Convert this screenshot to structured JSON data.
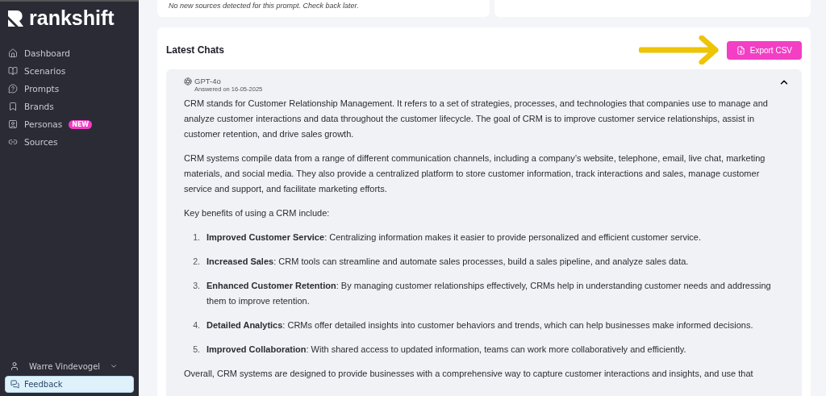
{
  "sidebar": {
    "logo": "rankshift",
    "items": [
      {
        "label": "Dashboard"
      },
      {
        "label": "Scenarios"
      },
      {
        "label": "Prompts"
      },
      {
        "label": "Brands"
      },
      {
        "label": "Personas",
        "badge": "NEW"
      },
      {
        "label": "Sources"
      }
    ],
    "user": "Warre Vindevogel",
    "feedback": "Feedback"
  },
  "top_card": {
    "text": "No new sources detected for this prompt. Check back later."
  },
  "latest_chats": {
    "title": "Latest Chats",
    "export_button": "Export CSV",
    "chat": {
      "model": "GPT-4o",
      "answered": "Answered on 16-05-2025",
      "expanded": true,
      "blocks": [
        {
          "kind": "p",
          "text": "CRM stands for Customer Relationship Management. It refers to a set of strategies, processes, and technologies that companies use to manage and analyze customer interactions and data throughout the customer lifecycle. The goal of CRM is to improve customer service relationships, assist in customer retention, and drive sales growth."
        },
        {
          "kind": "p",
          "text": "CRM systems compile data from a range of different communication channels, including a company’s website, telephone, email, live chat, marketing materials, and social media. They also provide a centralized platform to store customer information, track interactions and sales, manage customer service and support, and facilitate marketing efforts."
        },
        {
          "kind": "p",
          "text": "Key benefits of using a CRM include:"
        },
        {
          "kind": "list",
          "items": [
            {
              "number": "1.",
              "text": "**Improved Customer Service**: Centralizing information makes it easier to provide personalized and efficient customer service."
            },
            {
              "number": "2.",
              "text": "**Increased Sales**: CRM tools can streamline and automate sales processes, build a sales pipeline, and analyze sales data."
            },
            {
              "number": "3.",
              "text": "**Enhanced Customer Retention**: By managing customer relationships effectively, CRMs help in understanding customer needs and addressing them to improve retention."
            },
            {
              "number": "4.",
              "text": "**Detailed Analytics**: CRMs offer detailed insights into customer behaviors and trends, which can help businesses make informed decisions."
            },
            {
              "number": "5.",
              "text": "**Improved Collaboration**: With shared access to updated information, teams can work more collaboratively and efficiently."
            }
          ]
        },
        {
          "kind": "p",
          "text": "Overall, CRM systems are designed to provide businesses with a comprehensive way to capture customer interactions and insights, and use that"
        }
      ]
    }
  }
}
